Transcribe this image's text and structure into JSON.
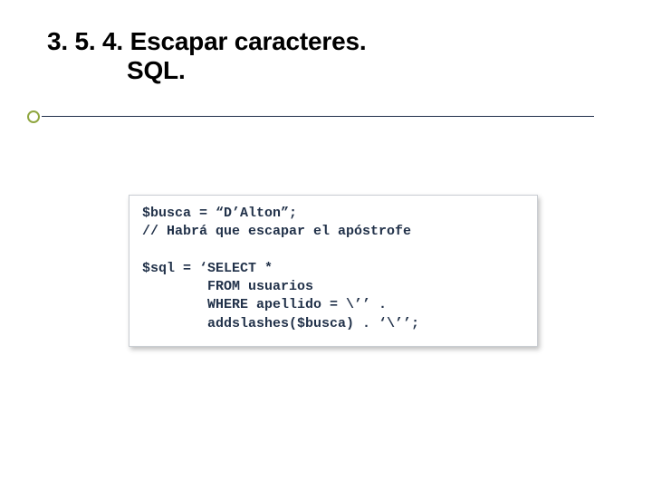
{
  "title": {
    "line1": "3. 5. 4. Escapar caracteres.",
    "line2": "SQL."
  },
  "code": {
    "l1": "$busca = “D’Alton”;",
    "l2": "// Habrá que escapar el apóstrofe",
    "l3": "",
    "l4": "$sql = ‘SELECT *",
    "l5": "        FROM usuarios",
    "l6": "        WHERE apellido = \\’’ .",
    "l7": "        addslashes($busca) . ‘\\’’;"
  }
}
